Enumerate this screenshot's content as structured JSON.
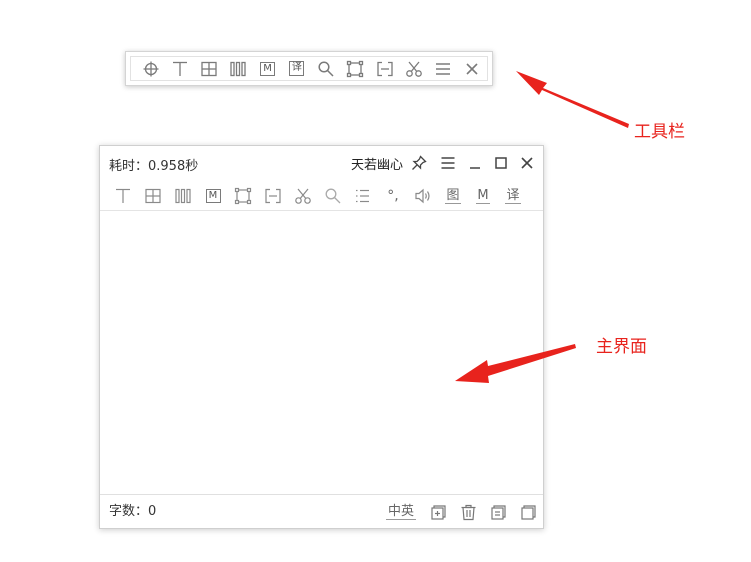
{
  "toolbar": {
    "icons": [
      "crosshair-icon",
      "text-icon",
      "table-icon",
      "columns-icon",
      "markdown-icon",
      "translate-icon",
      "search-icon",
      "fullscreen-icon",
      "region-icon",
      "scissors-icon",
      "menu-icon",
      "close-icon"
    ],
    "markdown_glyph": "M",
    "translate_glyph": "译"
  },
  "window": {
    "elapsed": "耗时：0.958秒",
    "brand": "天若幽心",
    "tools": {
      "markdown_glyph": "M",
      "punct_glyph": "°,",
      "image_label": "图",
      "md_label": "M",
      "translate_label": "译"
    },
    "text_content": "",
    "char_count": "字数：0",
    "lang_toggle": "中英"
  },
  "annotations": {
    "toolbar_label": "工具栏",
    "main_label": "主界面",
    "arrow_color": "#e8231d"
  }
}
